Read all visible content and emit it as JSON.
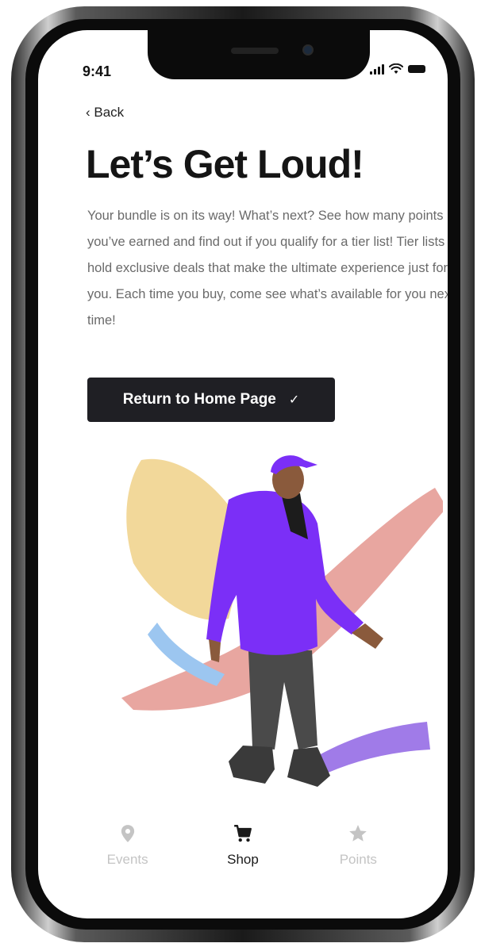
{
  "status_bar": {
    "time": "9:41"
  },
  "nav": {
    "back_label": "‹ Back"
  },
  "content": {
    "headline": "Let’s Get Loud!",
    "body": "Your bundle is on its way! What’s next? See how many points you’ve earned and find out if you qualify for a tier list! Tier lists hold exclusive deals that make the ultimate experience just for you. Each time you buy, come see what’s available for you next time!",
    "cta_label": "Return to Home Page",
    "cta_icon": "✓"
  },
  "illustration": {
    "subject": "person-in-purple-hoodie-walking",
    "colors": {
      "jacket": "#7b2ff7",
      "cap": "#7b2ff7",
      "pants": "#4a4a4a",
      "yellow_shape": "#f2d89a",
      "pink_shape": "#e8a6a0",
      "blue_shape": "#9cc6f0",
      "purple_shape": "#a07be8"
    }
  },
  "tab_bar": {
    "tabs": [
      {
        "label": "Events",
        "icon": "location-pin-icon",
        "active": false
      },
      {
        "label": "Shop",
        "icon": "shopping-cart-icon",
        "active": true
      },
      {
        "label": "Points",
        "icon": "star-icon",
        "active": false
      }
    ]
  },
  "colors": {
    "button_bg": "#1f1f24",
    "active_tab": "#1a1a1a",
    "inactive_tab": "#c4c4c4"
  }
}
